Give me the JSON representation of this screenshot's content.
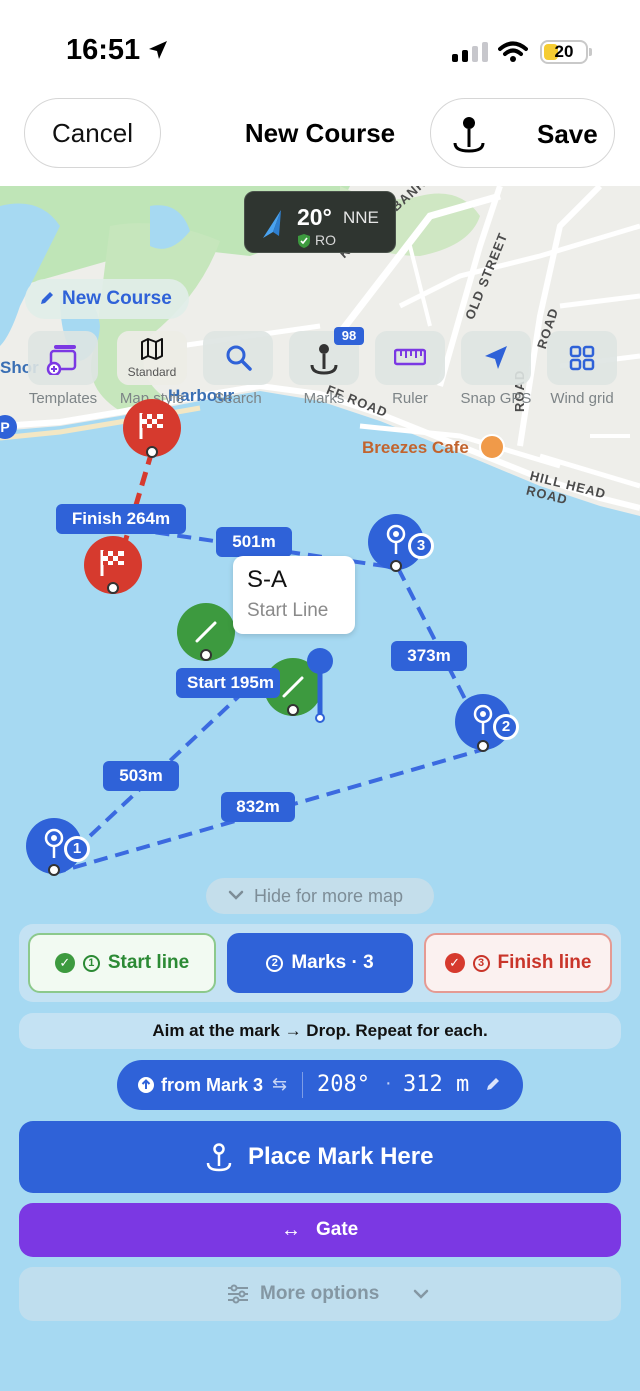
{
  "status_bar": {
    "time": "16:51",
    "battery": "20"
  },
  "header": {
    "cancel_label": "Cancel",
    "title": "New Course",
    "save_label": "Save"
  },
  "wind": {
    "degrees": "20°",
    "direction": "NNE",
    "source": "RO"
  },
  "map": {
    "course_chip": "New Course",
    "tools": [
      {
        "label": "Templates",
        "icon": "templates-icon"
      },
      {
        "label": "Map style",
        "sublabel": "Standard",
        "icon": "map-icon"
      },
      {
        "label": "Search",
        "icon": "search-icon"
      },
      {
        "label": "Marks",
        "badge": "98",
        "icon": "anchor-pin-icon"
      },
      {
        "label": "Ruler",
        "icon": "ruler-icon"
      },
      {
        "label": "Snap GPS",
        "icon": "navigation-arrow-icon"
      },
      {
        "label": "Wind grid",
        "icon": "grid-icon"
      }
    ],
    "road_labels": [
      "KNIGHTS BANK ROAD",
      "OLD STREET",
      "HILL HEAD ROAD",
      "ROAD",
      "FF ROAD",
      "ROAD"
    ],
    "place_labels": [
      "Harbour",
      "Shor"
    ],
    "cafe": "Breezes Cafe",
    "legs": {
      "finish": "Finish 264m",
      "leg_3_start": "501m",
      "leg_2_3": "373m",
      "start_line": "Start 195m",
      "leg_1_start": "503m",
      "leg_1_2": "832m"
    },
    "marks": [
      "1",
      "2",
      "3"
    ],
    "tooltip": {
      "title": "S-A",
      "subtitle": "Start Line"
    },
    "hide_label": "Hide for more map"
  },
  "steps": [
    {
      "num": "1",
      "label": "Start line"
    },
    {
      "num": "2",
      "label": "Marks · 3"
    },
    {
      "num": "3",
      "label": "Finish line"
    }
  ],
  "hint": "Aim at the mark → Drop. Repeat for each.",
  "bearing_chip": {
    "from": "from Mark 3",
    "bearing": "208°",
    "distance": "312 m"
  },
  "place_button": "Place Mark Here",
  "gate_button": "Gate",
  "more_button": "More options",
  "colors": {
    "accent": "#2f62d8",
    "gate": "#7b38e3",
    "start": "#3d9a3f",
    "finish": "#d63a2e",
    "water": "#a6d9f2"
  }
}
